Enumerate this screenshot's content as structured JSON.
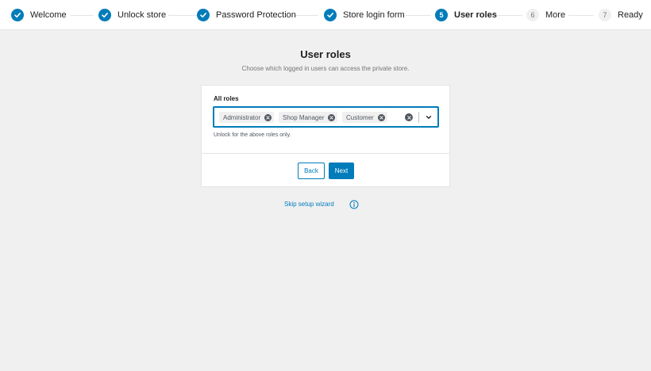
{
  "stepper": {
    "steps": [
      {
        "number": "1",
        "label": "Welcome",
        "state": "done"
      },
      {
        "number": "2",
        "label": "Unlock store",
        "state": "done"
      },
      {
        "number": "3",
        "label": "Password Protection",
        "state": "done"
      },
      {
        "number": "4",
        "label": "Store login form",
        "state": "done"
      },
      {
        "number": "5",
        "label": "User roles",
        "state": "active"
      },
      {
        "number": "6",
        "label": "More",
        "state": "todo"
      },
      {
        "number": "7",
        "label": "Ready",
        "state": "todo"
      }
    ]
  },
  "page": {
    "title": "User roles",
    "subtitle": "Choose which logged in users can access the private store."
  },
  "form": {
    "field_label": "All roles",
    "selected_roles": [
      "Administrator",
      "Shop Manager",
      "Customer"
    ],
    "help_text": "Unlock for the above roles only."
  },
  "actions": {
    "back_label": "Back",
    "next_label": "Next",
    "skip_label": "Skip setup wizard"
  },
  "colors": {
    "accent": "#007cba",
    "background": "#f0f0f1"
  },
  "icons": {
    "completed_step": "check-icon",
    "remove_tag": "close-icon",
    "clear_all": "close-icon",
    "dropdown": "chevron-down-icon",
    "info": "info-icon"
  }
}
